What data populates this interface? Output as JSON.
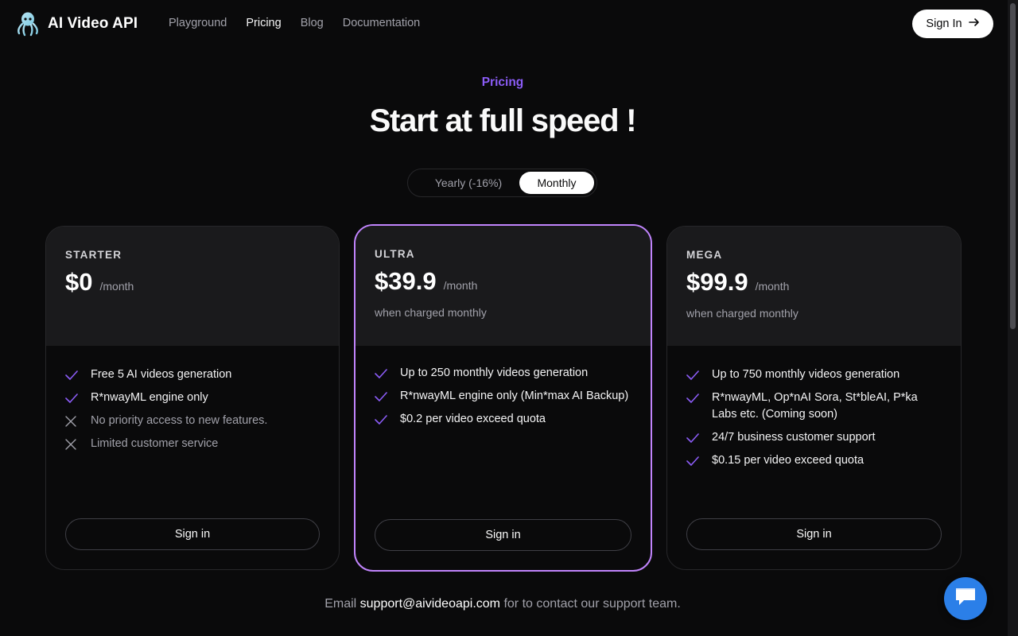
{
  "brand": {
    "name": "AI Video API",
    "logo_icon": "octopus-icon",
    "accent": "#8b5cf6",
    "highlight_border": "#c084fc",
    "chat_color": "#2b7fe8"
  },
  "nav": [
    {
      "label": "Playground",
      "active": false
    },
    {
      "label": "Pricing",
      "active": true
    },
    {
      "label": "Blog",
      "active": false
    },
    {
      "label": "Documentation",
      "active": false
    }
  ],
  "header": {
    "sign_in_label": "Sign In"
  },
  "hero": {
    "eyebrow": "Pricing",
    "title": "Start at full speed !"
  },
  "billing_toggle": {
    "yearly_label": "Yearly (-16%)",
    "monthly_label": "Monthly",
    "selected": "Monthly"
  },
  "plans": [
    {
      "name": "STARTER",
      "price": "$0",
      "per": "/month",
      "charged": "",
      "features": [
        {
          "text": "Free 5 AI videos generation",
          "included": true
        },
        {
          "text": "R*nwayML engine only",
          "included": true
        },
        {
          "text": "No priority access to new features.",
          "included": false
        },
        {
          "text": "Limited customer service",
          "included": false
        }
      ],
      "button": "Sign in"
    },
    {
      "name": "ULTRA",
      "price": "$39.9",
      "per": "/month",
      "charged": "when charged monthly",
      "features": [
        {
          "text": "Up to 250 monthly videos generation",
          "included": true
        },
        {
          "text": "R*nwayML engine only (Min*max AI Backup)",
          "included": true
        },
        {
          "text": "$0.2 per video exceed quota",
          "included": true
        }
      ],
      "button": "Sign in"
    },
    {
      "name": "MEGA",
      "price": "$99.9",
      "per": "/month",
      "charged": "when charged monthly",
      "features": [
        {
          "text": "Up to 750 monthly videos generation",
          "included": true
        },
        {
          "text": "R*nwayML, Op*nAI Sora, St*bleAI, P*ka Labs etc. (Coming soon)",
          "included": true
        },
        {
          "text": "24/7 business customer support",
          "included": true
        },
        {
          "text": "$0.15 per video exceed quota",
          "included": true
        }
      ],
      "button": "Sign in"
    }
  ],
  "footer": {
    "prefix": "Email",
    "email": "support@aivideoapi.com",
    "suffix": "for to contact our support team."
  }
}
